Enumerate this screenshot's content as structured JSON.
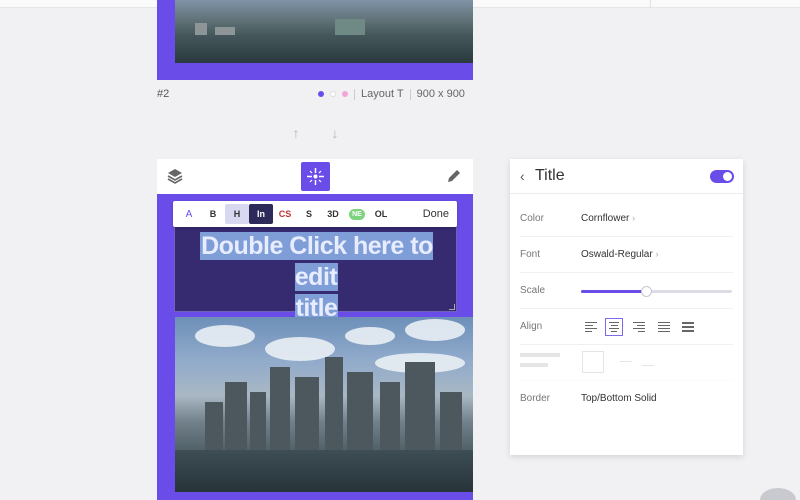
{
  "card1": {
    "number": "#2",
    "layout_label": "Layout T",
    "size": "900 x 900",
    "dots": [
      "#6a4de8",
      "#ffffff",
      "#f4a5d8"
    ]
  },
  "editor": {
    "title_line1": "Double Click ",
    "title_cursor_word": "here",
    "title_line1_end": " to edit",
    "title_line2": "title",
    "toolbar": [
      {
        "name": "text-color-button",
        "label": "A",
        "style": "a"
      },
      {
        "name": "bold-button",
        "label": "B",
        "style": ""
      },
      {
        "name": "heading-button",
        "label": "H",
        "style": "h"
      },
      {
        "name": "indent-button",
        "label": "In",
        "style": "in"
      },
      {
        "name": "css-button",
        "label": "CS",
        "style": "cs"
      },
      {
        "name": "shadow-button",
        "label": "S",
        "style": ""
      },
      {
        "name": "3d-button",
        "label": "3D",
        "style": ""
      },
      {
        "name": "neon-button",
        "label": "NE",
        "style": "green"
      },
      {
        "name": "outline-button",
        "label": "OL",
        "style": ""
      }
    ],
    "done_label": "Done"
  },
  "panel": {
    "title": "Title",
    "toggle_on": true,
    "rows": {
      "color": {
        "label": "Color",
        "value": "Cornflower"
      },
      "font": {
        "label": "Font",
        "value": "Oswald-Regular"
      },
      "scale": {
        "label": "Scale",
        "value": 0.43
      },
      "align": {
        "label": "Align",
        "selected": "center"
      },
      "border": {
        "label": "Border",
        "value": "Top/Bottom Solid"
      }
    }
  },
  "colors": {
    "accent": "#6a4de8"
  }
}
